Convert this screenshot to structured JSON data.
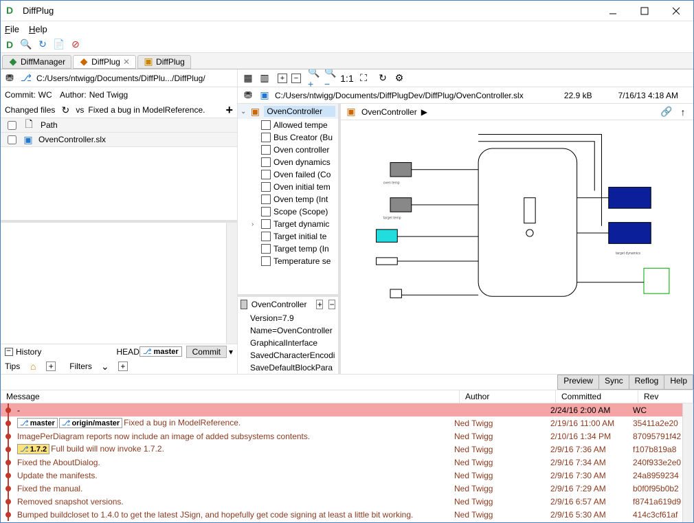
{
  "window": {
    "title": "DiffPlug"
  },
  "menu": {
    "file": "File",
    "help": "Help"
  },
  "tabs": [
    {
      "label": "DiffManager"
    },
    {
      "label": "DiffPlug",
      "active": true
    },
    {
      "label": "DiffPlug"
    }
  ],
  "left": {
    "path": "C:/Users/ntwigg/Documents/DiffPlu.../DiffPlug/",
    "commit_lbl": "Commit:",
    "commit_val": "WC",
    "author_lbl": "Author:",
    "author_val": "Ned Twigg",
    "changed_lbl": "Changed files",
    "vs": "vs",
    "vs_val": "Fixed a bug in ModelReference.",
    "path_hdr": "Path",
    "file": "OvenController.slx",
    "history": "History",
    "head": "HEAD",
    "branch": "master",
    "commit_btn": "Commit",
    "tips": "Tips",
    "filters": "Filters"
  },
  "right": {
    "path": "C:/Users/ntwigg/Documents/DiffPlugDev/DiffPlug/OvenController.slx",
    "size": "22.9 kB",
    "date": "7/16/13 4:18 AM",
    "tree_root": "OvenController",
    "tree_items": [
      "Allowed tempe",
      "Bus Creator (Bu",
      "Oven controller",
      "Oven dynamics",
      "Oven failed (Co",
      "Oven initial tem",
      "Oven temp (Int",
      "Scope (Scope)",
      "Target dynamic",
      "Target initial te",
      "Target temp (In",
      "Temperature se"
    ],
    "prop_root": "OvenController",
    "props": [
      "Version=7.9",
      "Name=OvenController",
      "GraphicalInterface",
      "SavedCharacterEncodi",
      "SaveDefaultBlockPara"
    ],
    "diagram_title": "OvenController"
  },
  "commit_tabs": {
    "preview": "Preview",
    "sync": "Sync",
    "reflog": "Reflog",
    "help": "Help"
  },
  "commit_hdr": {
    "msg": "Message",
    "auth": "Author",
    "comm": "Committed",
    "rev": "Rev"
  },
  "commits": [
    {
      "msg": "-",
      "auth": "",
      "comm": "2/24/16 2:00 AM",
      "rev": "WC",
      "wc": true
    },
    {
      "msg": "Fixed a bug in ModelReference.",
      "auth": "Ned Twigg",
      "comm": "2/19/16 11:00 AM",
      "rev": "35411a2e20",
      "chips": [
        {
          "t": "master",
          "y": false
        },
        {
          "t": "origin/master",
          "y": false
        }
      ]
    },
    {
      "msg": "ImagePerDiagram reports now include an image of added subsystems contents.",
      "auth": "Ned Twigg",
      "comm": "2/10/16 1:34 PM",
      "rev": "87095791f42"
    },
    {
      "msg": "Full build will now invoke 1.7.2.",
      "auth": "Ned Twigg",
      "comm": "2/9/16 7:36 AM",
      "rev": "f107b819a8",
      "chips": [
        {
          "t": "1.7.2",
          "y": true
        }
      ]
    },
    {
      "msg": "Fixed the AboutDialog.",
      "auth": "Ned Twigg",
      "comm": "2/9/16 7:34 AM",
      "rev": "240f933e2e0"
    },
    {
      "msg": "Update the manifests.",
      "auth": "Ned Twigg",
      "comm": "2/9/16 7:30 AM",
      "rev": "24a8959234"
    },
    {
      "msg": "Fixed the manual.",
      "auth": "Ned Twigg",
      "comm": "2/9/16 7:29 AM",
      "rev": "b0f0f95b0b2"
    },
    {
      "msg": "Removed snapshot versions.",
      "auth": "Ned Twigg",
      "comm": "2/9/16 6:57 AM",
      "rev": "f8741a619d9"
    },
    {
      "msg": "Bumped buildcloset to 1.4.0 to get the latest JSign, and hopefully get code signing at least a little bit working.",
      "auth": "Ned Twigg",
      "comm": "2/9/16 5:30 AM",
      "rev": "414c3cf61af"
    }
  ]
}
